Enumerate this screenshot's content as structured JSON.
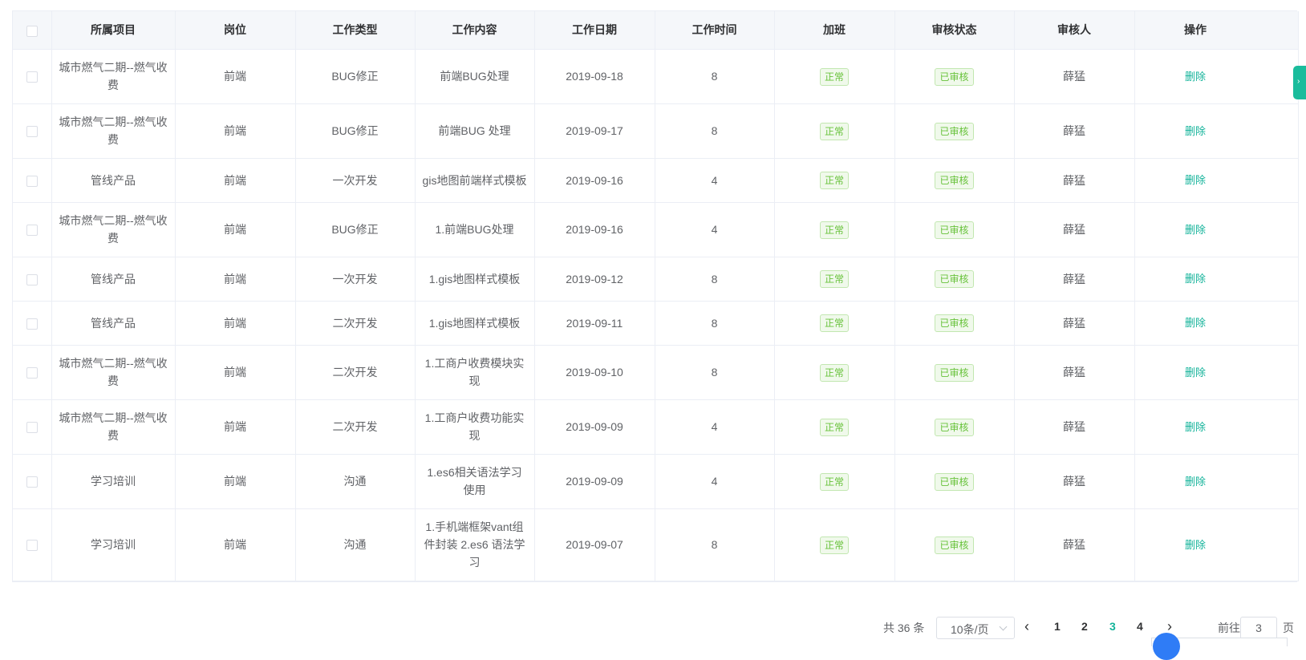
{
  "columns": [
    "所属项目",
    "岗位",
    "工作类型",
    "工作内容",
    "工作日期",
    "工作时间",
    "加班",
    "审核状态",
    "审核人",
    "操作"
  ],
  "rows": [
    {
      "project": "城市燃气二期--燃气收费",
      "post": "前端",
      "type": "BUG修正",
      "content": "前端BUG处理",
      "date": "2019-09-18",
      "hours": "8",
      "overtime": "正常",
      "status": "已审核",
      "reviewer": "薛猛",
      "action": "删除"
    },
    {
      "project": "城市燃气二期--燃气收费",
      "post": "前端",
      "type": "BUG修正",
      "content": "前端BUG 处理",
      "date": "2019-09-17",
      "hours": "8",
      "overtime": "正常",
      "status": "已审核",
      "reviewer": "薛猛",
      "action": "删除"
    },
    {
      "project": "管线产品",
      "post": "前端",
      "type": "一次开发",
      "content": "gis地图前端样式模板",
      "date": "2019-09-16",
      "hours": "4",
      "overtime": "正常",
      "status": "已审核",
      "reviewer": "薛猛",
      "action": "删除"
    },
    {
      "project": "城市燃气二期--燃气收费",
      "post": "前端",
      "type": "BUG修正",
      "content": "1.前端BUG处理",
      "date": "2019-09-16",
      "hours": "4",
      "overtime": "正常",
      "status": "已审核",
      "reviewer": "薛猛",
      "action": "删除"
    },
    {
      "project": "管线产品",
      "post": "前端",
      "type": "一次开发",
      "content": "1.gis地图样式模板",
      "date": "2019-09-12",
      "hours": "8",
      "overtime": "正常",
      "status": "已审核",
      "reviewer": "薛猛",
      "action": "删除"
    },
    {
      "project": "管线产品",
      "post": "前端",
      "type": "二次开发",
      "content": "1.gis地图样式模板",
      "date": "2019-09-11",
      "hours": "8",
      "overtime": "正常",
      "status": "已审核",
      "reviewer": "薛猛",
      "action": "删除"
    },
    {
      "project": "城市燃气二期--燃气收费",
      "post": "前端",
      "type": "二次开发",
      "content": "1.工商户收费模块实现",
      "date": "2019-09-10",
      "hours": "8",
      "overtime": "正常",
      "status": "已审核",
      "reviewer": "薛猛",
      "action": "删除"
    },
    {
      "project": "城市燃气二期--燃气收费",
      "post": "前端",
      "type": "二次开发",
      "content": "1.工商户收费功能实现",
      "date": "2019-09-09",
      "hours": "4",
      "overtime": "正常",
      "status": "已审核",
      "reviewer": "薛猛",
      "action": "删除"
    },
    {
      "project": "学习培训",
      "post": "前端",
      "type": "沟通",
      "content": "1.es6相关语法学习使用",
      "date": "2019-09-09",
      "hours": "4",
      "overtime": "正常",
      "status": "已审核",
      "reviewer": "薛猛",
      "action": "删除"
    },
    {
      "project": "学习培训",
      "post": "前端",
      "type": "沟通",
      "content": "1.手机端框架vant组件封装 2.es6 语法学习",
      "date": "2019-09-07",
      "hours": "8",
      "overtime": "正常",
      "status": "已审核",
      "reviewer": "薛猛",
      "action": "删除"
    }
  ],
  "pagination": {
    "total_text": "共 36 条",
    "page_size": "10条/页",
    "pages": [
      "1",
      "2",
      "3",
      "4"
    ],
    "current_page": "3",
    "goto_label": "前往",
    "goto_value": "3",
    "goto_unit": "页",
    "prev_icon": "chevron-left-icon",
    "next_icon": "chevron-right-icon"
  },
  "colors": {
    "accent": "#13b39a",
    "tag_green": "#67c23a",
    "header_bg": "#f5f7fa",
    "border": "#ebeef5"
  }
}
